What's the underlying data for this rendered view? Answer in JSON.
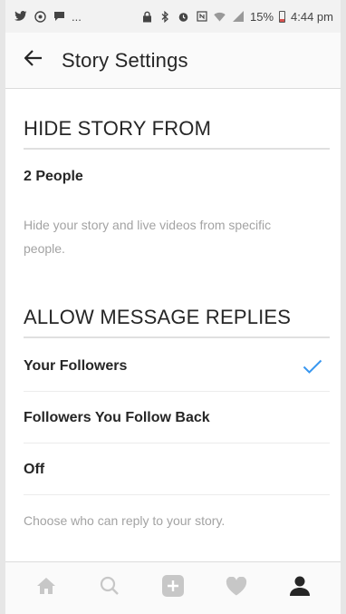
{
  "status_bar": {
    "left_icons": [
      "twitter-icon",
      "messenger-icon",
      "chat-icon"
    ],
    "ellipsis": "...",
    "battery": "15%",
    "time": "4:44 pm"
  },
  "app_bar": {
    "title": "Story Settings"
  },
  "hide_story": {
    "header": "HIDE STORY FROM",
    "people_label": "2 People",
    "description": "Hide your story and live videos from specific people."
  },
  "message_replies": {
    "header": "ALLOW MESSAGE REPLIES",
    "options": [
      {
        "label": "Your Followers",
        "selected": true
      },
      {
        "label": "Followers You Follow Back",
        "selected": false
      },
      {
        "label": "Off",
        "selected": false
      }
    ],
    "description": "Choose who can reply to your story."
  },
  "bottom_nav": {
    "items": [
      "home-icon",
      "search-icon",
      "add-post-icon",
      "heart-icon",
      "profile-icon"
    ],
    "active": "profile-icon"
  },
  "colors": {
    "accent_check": "#3897f0",
    "text": "#262626",
    "muted": "#a3a3a3"
  }
}
